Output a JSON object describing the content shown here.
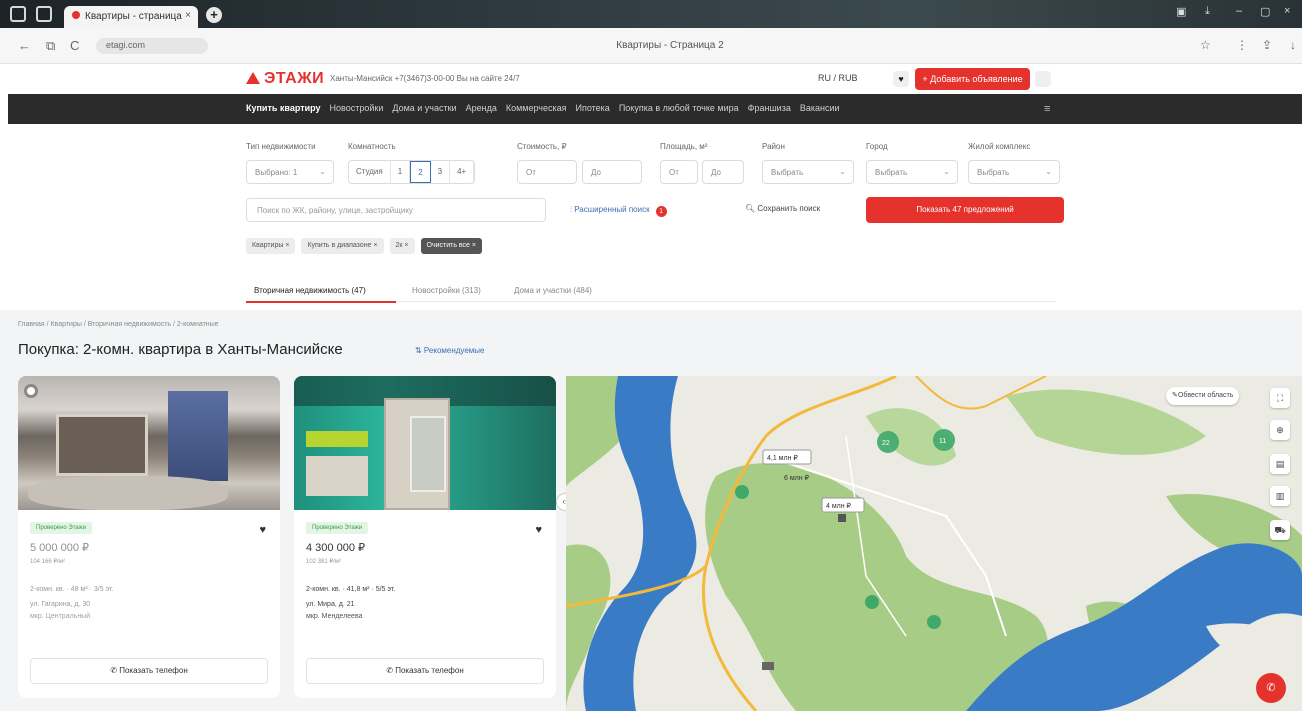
{
  "browser": {
    "tab_title": "Квартиры - страница",
    "tab_close": "×",
    "new_tab": "+",
    "url": "etagi.com",
    "page_title": "Квартиры - Страница 2",
    "back": "←",
    "forward": "→",
    "reload": "C"
  },
  "header": {
    "logo": "ЭТАЖИ",
    "info": "Ханты-Мансийск +7(3467)3-00-00 Вы на сайте 24/7",
    "lang": "RU / RUB",
    "fav": "♥",
    "add_ad": "+ Добавить объявление"
  },
  "nav": {
    "items": [
      "Купить квартиру",
      "Новостройки",
      "Дома и участки",
      "Аренда",
      "Коммерческая",
      "Ипотека",
      "Покупка в любой точке мира",
      "Франшиза",
      "Вакансии"
    ],
    "menu_icon": "≡"
  },
  "filters": {
    "labels": {
      "property_type": "Тип недвижимости",
      "rooms": "Комнатность",
      "price": "Стоимость, ₽",
      "area": "Площадь, м²",
      "district": "Район",
      "city": "Город",
      "complex": "Жилой комплекс"
    },
    "property_type_value": "Выбрано: 1",
    "rooms": [
      "Студия",
      "1",
      "2",
      "3",
      "4+"
    ],
    "price_from": "От",
    "price_to": "До",
    "area_from": "От",
    "area_to": "До",
    "district_value": "Выбрать",
    "city_value": "Выбрать",
    "complex_value": "Выбрать",
    "search_placeholder": "Поиск по ЖК, району, улице, застройщику",
    "extended": "Расширенный поиск",
    "extended_count": "1",
    "save_search": "Сохранить поиск",
    "show_button": "Показать 47 предложений",
    "chips": [
      "Квартиры ×",
      "Купить в диапазоне ×",
      "2к ×",
      "Очистить все ×"
    ]
  },
  "tabs": [
    "Вторичная недвижимость (47)",
    "Новостройки (313)",
    "Дома и участки (484)"
  ],
  "page": {
    "breadcrumbs": "Главная  /  Квартиры  /  Вторичная недвижимость  /  2-комнатные",
    "heading": "Покупка: 2-комн. квартира в Ханты-Мансийске",
    "sort": "⇅ Рекомендуемые"
  },
  "cards": [
    {
      "tag": "Проверено Этажи",
      "price": "5 000 000 ₽",
      "ppm": "104 166 ₽/м²",
      "params": "2-комн. кв. · 48 м² · 3/5 эт.",
      "address": "ул. Гагарина, д. 30",
      "district": "мкр. Центральный",
      "phone": "Показать телефон"
    },
    {
      "tag": "Проверено Этажи",
      "price": "4 300 000 ₽",
      "ppm": "102 381 ₽/м²",
      "params": "2-комн. кв. · 41,8 м² · 5/5 эт.",
      "address": "ул. Мира, д. 21",
      "district": "мкр. Менделеева",
      "phone": "Показать телефон"
    }
  ],
  "map": {
    "draw_area": "Обвести область",
    "labels": [
      "4,1 млн ₽",
      "6 млн ₽",
      "4 млн ₽"
    ],
    "cluster_counts": [
      "22",
      "11"
    ],
    "fab": "✆"
  },
  "colors": {
    "brand": "#e5322d",
    "nav_bg": "#2b2b2b",
    "link": "#3d6fb0",
    "water": "#3a7bc6",
    "forest": "#a7cc86",
    "marker": "#3fa96a"
  }
}
